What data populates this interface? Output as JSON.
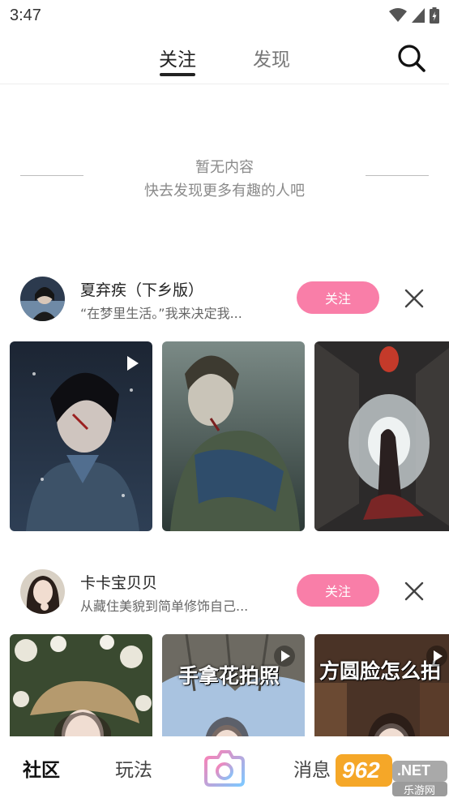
{
  "status_bar": {
    "time": "3:47"
  },
  "top_nav": {
    "tabs": [
      {
        "label": "关注",
        "active": true
      },
      {
        "label": "发现",
        "active": false
      }
    ]
  },
  "empty_state": {
    "title": "暂无内容",
    "subtitle": "快去发现更多有趣的人吧"
  },
  "recommendations": [
    {
      "name": "夏弃疾（下乡版）",
      "description": "“在梦里生活。”我来决定我...",
      "follow_label": "关注",
      "thumbnails": [
        {
          "has_play_icon": true,
          "caption": ""
        },
        {
          "has_play_icon": false,
          "caption": ""
        },
        {
          "has_play_icon": false,
          "caption": ""
        }
      ]
    },
    {
      "name": "卡卡宝贝贝",
      "description": "从藏住美貌到简单修饰自己...",
      "follow_label": "关注",
      "thumbnails": [
        {
          "has_play_icon": false,
          "caption": ""
        },
        {
          "has_play_icon": true,
          "caption": "手拿花拍照"
        },
        {
          "has_play_icon": true,
          "caption": "方圆脸怎么拍"
        }
      ]
    }
  ],
  "bottom_nav": {
    "community": "社区",
    "play": "玩法",
    "messages": "消息"
  },
  "watermark": {
    "number": "962",
    "suffix": ".NET",
    "site": "乐游网"
  },
  "colors": {
    "accent": "#f97ea8",
    "camera_gradient_start": "#ff7eb3",
    "camera_gradient_end": "#7ec8ff"
  }
}
